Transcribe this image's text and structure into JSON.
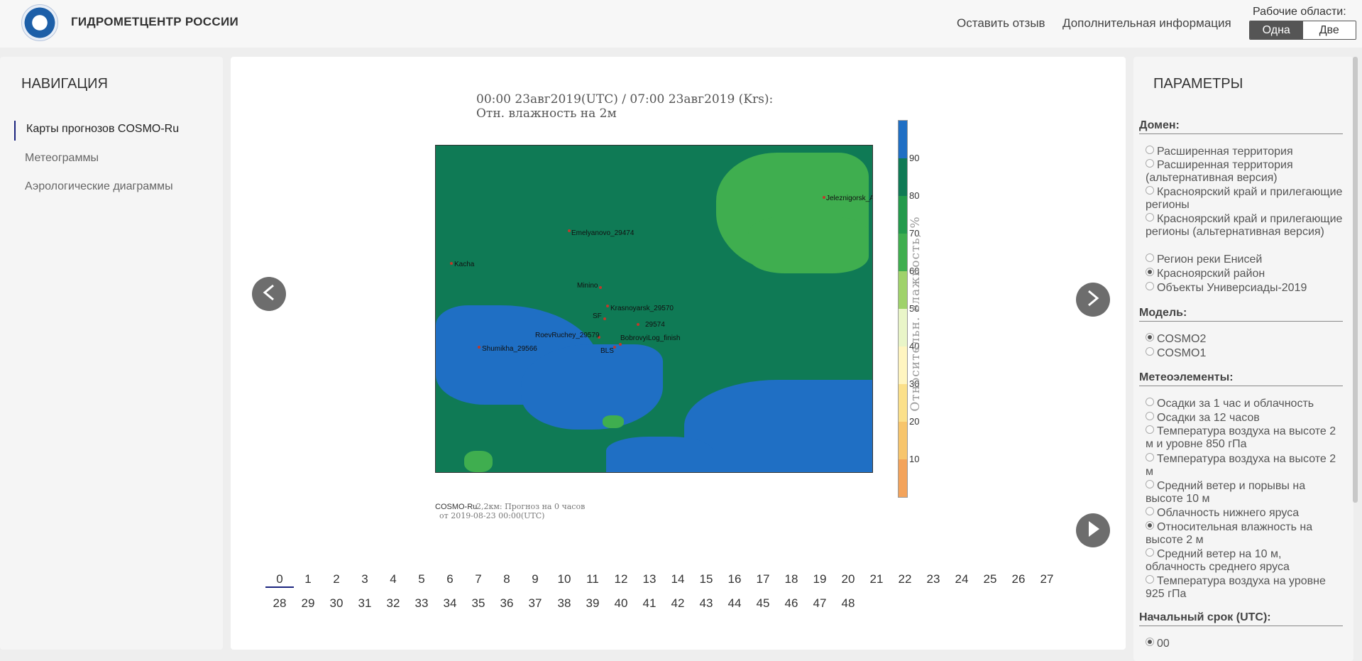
{
  "header": {
    "site_title": "ГИДРОМЕТЦЕНТР РОССИИ",
    "link_feedback": "Оставить отзыв",
    "link_info": "Дополнительная информация",
    "workspaces_label": "Рабочие области:",
    "workspace_one": "Одна",
    "workspace_two": "Две"
  },
  "nav": {
    "title": "НАВИГАЦИЯ",
    "items": [
      {
        "label": "Карты прогнозов COSMO-Ru",
        "active": true
      },
      {
        "label": "Метеограммы",
        "active": false
      },
      {
        "label": "Аэрологические диаграммы",
        "active": false
      }
    ]
  },
  "map": {
    "header_line1": "00:00 23авг2019(UTC) / 07:00 23авг2019 (Krs):",
    "header_line2": "Отн. влажность на 2м",
    "colorbar_label": "Относительн. влажность, %",
    "colorbar_ticks": [
      "90",
      "80",
      "70",
      "60",
      "50",
      "40",
      "30",
      "20",
      "10"
    ],
    "footer_brand": "COSMO-Ru",
    "footer_text": "2,2км: Прогноз на 0 часов",
    "footer_text2": "от 2019-08-23 00:00(UTC)",
    "stations": [
      "Jeleznigorsk_AMS",
      "Emelyanovo_29474",
      "Kacha",
      "Minino",
      "Krasnoyarsk_29570",
      "SF",
      "29574",
      "RoevRuchey_29579",
      "BobrovyiLog_finish",
      "BLS",
      "Shumikha_29566"
    ]
  },
  "steps_row1": [
    "0",
    "1",
    "2",
    "3",
    "4",
    "5",
    "6",
    "7",
    "8",
    "9",
    "10",
    "11",
    "12",
    "13",
    "14",
    "15",
    "16",
    "17",
    "18",
    "19",
    "20",
    "21",
    "22",
    "23",
    "24",
    "25",
    "26",
    "27"
  ],
  "steps_row2": [
    "28",
    "29",
    "30",
    "31",
    "32",
    "33",
    "34",
    "35",
    "36",
    "37",
    "38",
    "39",
    "40",
    "41",
    "42",
    "43",
    "44",
    "45",
    "46",
    "47",
    "48"
  ],
  "params": {
    "title": "ПАРАМЕТРЫ",
    "domain_title": "Домен:",
    "domain_options": [
      {
        "label": "Расширенная территория",
        "checked": false
      },
      {
        "label": "Расширенная территория (альтернативная версия)",
        "checked": false
      },
      {
        "label": "Красноярский край и прилегающие регионы",
        "checked": false
      },
      {
        "label": "Красноярский край и прилегающие регионы (альтернативная версия)",
        "checked": false
      },
      {
        "label": "Регион реки Енисей",
        "checked": false
      },
      {
        "label": "Красноярский район",
        "checked": true
      },
      {
        "label": "Объекты Универсиады-2019",
        "checked": false
      }
    ],
    "model_title": "Модель:",
    "model_options": [
      {
        "label": "COSMO2",
        "checked": true
      },
      {
        "label": "COSMO1",
        "checked": false
      }
    ],
    "elements_title": "Метеоэлементы:",
    "element_options": [
      {
        "label": "Осадки за 1 час и облачность",
        "checked": false
      },
      {
        "label": "Осадки за 12 часов",
        "checked": false
      },
      {
        "label": "Температура воздуха на высоте 2 м и уровне 850 гПа",
        "checked": false
      },
      {
        "label": "Температура воздуха на высоте 2 м",
        "checked": false
      },
      {
        "label": "Средний ветер и порывы на высоте 10 м",
        "checked": false
      },
      {
        "label": "Облачность нижнего яруса",
        "checked": false
      },
      {
        "label": "Относительная влажность на высоте 2 м",
        "checked": true
      },
      {
        "label": "Средний ветер на 10 м, облачность среднего яруса",
        "checked": false
      },
      {
        "label": "Температура воздуха на уровне 925 гПа",
        "checked": false
      }
    ],
    "start_title": "Начальный срок (UTC):",
    "start_options": [
      {
        "label": "00",
        "checked": true
      }
    ]
  }
}
